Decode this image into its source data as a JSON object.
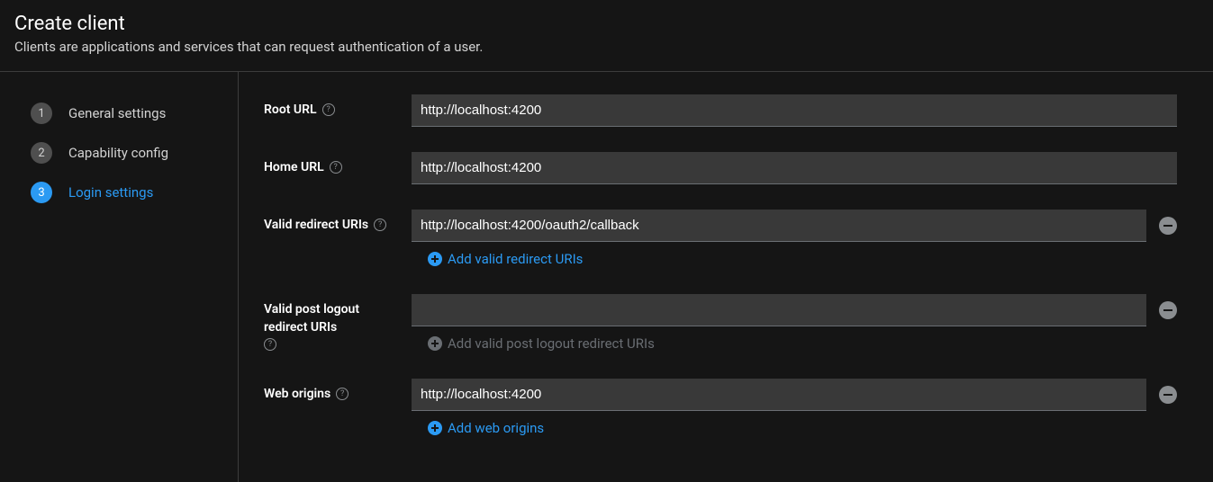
{
  "header": {
    "title": "Create client",
    "subtitle": "Clients are applications and services that can request authentication of a user."
  },
  "steps": [
    {
      "num": "1",
      "label": "General settings",
      "active": false
    },
    {
      "num": "2",
      "label": "Capability config",
      "active": false
    },
    {
      "num": "3",
      "label": "Login settings",
      "active": true
    }
  ],
  "form": {
    "root_url": {
      "label": "Root URL",
      "value": "http://localhost:4200"
    },
    "home_url": {
      "label": "Home URL",
      "value": "http://localhost:4200"
    },
    "redirect_uris": {
      "label": "Valid redirect URIs",
      "value": "http://localhost:4200/oauth2/callback",
      "add_label": "Add valid redirect URIs"
    },
    "post_logout": {
      "label": "Valid post logout redirect URIs",
      "value": "",
      "add_label": "Add valid post logout redirect URIs"
    },
    "web_origins": {
      "label": "Web origins",
      "value": "http://localhost:4200",
      "add_label": "Add web origins"
    }
  }
}
